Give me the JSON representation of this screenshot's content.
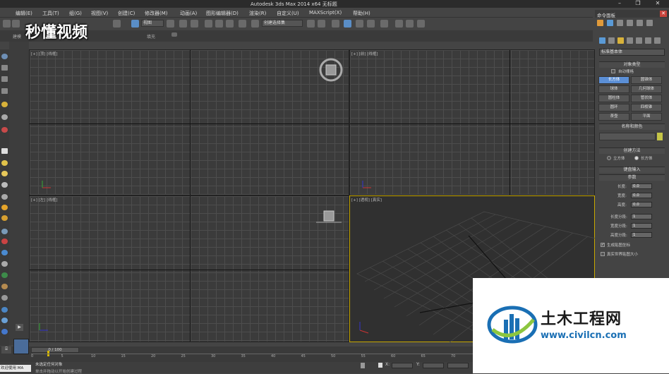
{
  "window": {
    "title": "Autodesk 3ds Max  2014 x64     无标题"
  },
  "menu": [
    "编辑(E)",
    "工具(T)",
    "组(G)",
    "视图(V)",
    "创建(C)",
    "修改器(M)",
    "动画(A)",
    "图形编辑器(D)",
    "渲染(R)",
    "自定义(U)",
    "MAXScript(X)",
    "帮助(H)"
  ],
  "toolbar": {
    "selection_filter": "视图",
    "named_selection": "创建选择集"
  },
  "ribbon": {
    "tabs": [
      "建模",
      "",
      "",
      "",
      "填充"
    ]
  },
  "watermark": {
    "text": "秒懂视频"
  },
  "viewports": {
    "top": "[+] [顶] [线框]",
    "front": "[+] [前] [线框]",
    "left": "[+] [左] [线框]",
    "persp": "[+] [透视] [真实]"
  },
  "timeline": {
    "counter": "0 / 100",
    "ticks": [
      "0",
      "5",
      "10",
      "15",
      "20",
      "25",
      "30",
      "35",
      "40",
      "45",
      "50",
      "55",
      "60",
      "65",
      "70"
    ]
  },
  "status": {
    "mini_listener": "欢迎使用 MA",
    "line1": "未选定任何对象",
    "line2": "单击并拖动以开始创建过程",
    "x_label": "X:",
    "y_label": "Y:"
  },
  "command_panel": {
    "title": "命令面板",
    "category": "标准基本体",
    "object_type": {
      "header": "对象类型",
      "autogrid": "自动栅格",
      "buttons": [
        "长方体",
        "圆锥体",
        "球体",
        "几何球体",
        "圆柱体",
        "管状体",
        "圆环",
        "四棱锥",
        "茶壶",
        "平面"
      ],
      "active": "长方体"
    },
    "name_color": {
      "header": "名称和颜色",
      "swatch": "#c5c547"
    },
    "creation_method": {
      "header": "创建方法",
      "options": [
        "立方体",
        "长方体"
      ],
      "selected": "长方体"
    },
    "keyboard_entry": {
      "header": "键盘输入"
    },
    "parameters": {
      "header": "参数",
      "fields": [
        {
          "label": "长度:",
          "value": "0.0"
        },
        {
          "label": "宽度:",
          "value": "0.0"
        },
        {
          "label": "高度:",
          "value": "0.0"
        }
      ],
      "segments": [
        {
          "label": "长度分段:",
          "value": "1"
        },
        {
          "label": "宽度分段:",
          "value": "1"
        },
        {
          "label": "高度分段:",
          "value": "1"
        }
      ],
      "gen_uv": "生成贴图坐标",
      "gen_uv_checked": true,
      "real_world": "真实世界贴图大小",
      "real_world_checked": false
    }
  },
  "logo": {
    "title": "土木工程网",
    "url": "www.civilcn.com"
  }
}
